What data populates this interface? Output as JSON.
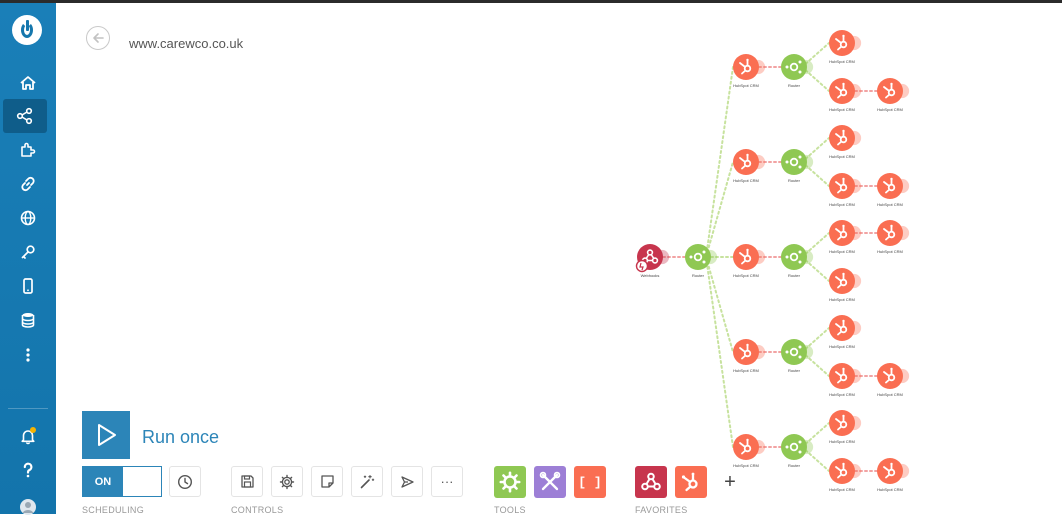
{
  "page": {
    "title": "www.carewco.co.uk"
  },
  "sidebar": {
    "items": [
      {
        "name": "home",
        "icon": "home-icon"
      },
      {
        "name": "scenarios",
        "icon": "share-icon",
        "active": true
      },
      {
        "name": "templates",
        "icon": "puzzle-icon"
      },
      {
        "name": "connections",
        "icon": "link-icon"
      },
      {
        "name": "webhooks",
        "icon": "globe-icon"
      },
      {
        "name": "keys",
        "icon": "key-icon"
      },
      {
        "name": "devices",
        "icon": "phone-icon"
      },
      {
        "name": "data-stores",
        "icon": "database-icon"
      },
      {
        "name": "more",
        "icon": "more-vertical-icon"
      }
    ],
    "bottom": [
      {
        "name": "notifications",
        "icon": "bell-icon",
        "badge": true
      },
      {
        "name": "help",
        "icon": "question-icon"
      },
      {
        "name": "profile",
        "icon": "avatar-icon"
      }
    ]
  },
  "run": {
    "label": "Run once"
  },
  "scheduling": {
    "toggle_label": "ON",
    "section_label": "SCHEDULING"
  },
  "controls": {
    "section_label": "CONTROLS",
    "buttons": [
      "save-icon",
      "settings-gear-icon",
      "notes-icon",
      "magic-wand-icon",
      "airplane-icon",
      "more-horizontal-icon"
    ],
    "more_label": "···"
  },
  "tools": {
    "section_label": "TOOLS",
    "items": [
      {
        "name": "flow-control-tool",
        "icon": "gear-icon",
        "color": "#8fc853"
      },
      {
        "name": "tools-tool",
        "icon": "crossed-tools-icon",
        "color": "#9d7fd6"
      },
      {
        "name": "text-parser-tool",
        "icon": "brackets-icon",
        "color": "#fa6e52",
        "label": "[ ]"
      }
    ]
  },
  "favorites": {
    "section_label": "FAVORITES",
    "items": [
      {
        "name": "webhooks-favorite",
        "icon": "webhooks-icon",
        "color": "#c7354d"
      },
      {
        "name": "hubspot-favorite",
        "icon": "hubspot-icon",
        "color": "#fa6e52"
      }
    ],
    "add_label": "+"
  },
  "scenario": {
    "colors": {
      "hubspot": "#fa6e52",
      "router": "#8fc853",
      "webhook": "#c7354d"
    },
    "trigger": {
      "label": "Webhooks"
    },
    "main_router": {
      "label": "Router"
    },
    "branches": [
      {
        "module": "HubSpot CRM",
        "router": "Router",
        "outputs": [
          {
            "label": "HubSpot CRM"
          },
          {
            "label": "HubSpot CRM",
            "next": "HubSpot CRM"
          }
        ]
      },
      {
        "module": "HubSpot CRM",
        "router": "Router",
        "outputs": [
          {
            "label": "HubSpot CRM"
          },
          {
            "label": "HubSpot CRM",
            "next": "HubSpot CRM"
          }
        ]
      },
      {
        "module": "HubSpot CRM",
        "router": "Router",
        "outputs": [
          {
            "label": "HubSpot CRM",
            "next": "HubSpot CRM"
          },
          {
            "label": "HubSpot CRM"
          }
        ]
      },
      {
        "module": "HubSpot CRM",
        "router": "Router",
        "outputs": [
          {
            "label": "HubSpot CRM"
          },
          {
            "label": "HubSpot CRM",
            "next": "HubSpot CRM"
          }
        ]
      },
      {
        "module": "HubSpot CRM",
        "router": "Router",
        "outputs": [
          {
            "label": "HubSpot CRM"
          },
          {
            "label": "HubSpot CRM",
            "next": "HubSpot CRM"
          }
        ]
      }
    ]
  }
}
